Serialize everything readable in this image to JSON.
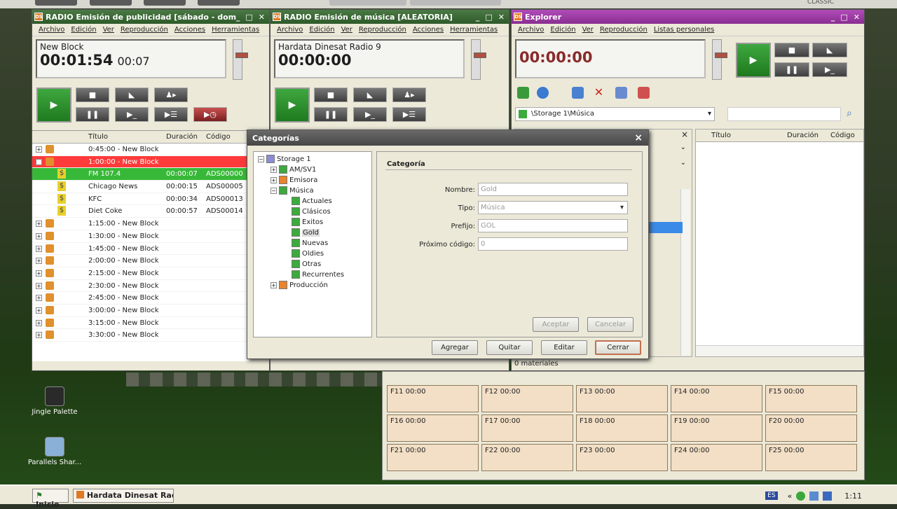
{
  "desktop": {
    "icons": [
      {
        "label": "Jingle Palette"
      },
      {
        "label": "Parallels Shar..."
      }
    ]
  },
  "ads_window": {
    "title": "RADIO Emisión de publicidad [sábado - domin...",
    "menu": [
      "Archivo",
      "Edición",
      "Ver",
      "Reproducción",
      "Acciones",
      "Herramientas"
    ],
    "display_line1": "New Block",
    "display_time": "00:01:54",
    "display_remaining": "00:07",
    "columns": [
      "Título",
      "Duración",
      "Código"
    ],
    "rows": [
      {
        "kind": "block",
        "title": "0:45:00 - New Block",
        "duration": "",
        "code": "",
        "expand": "+"
      },
      {
        "kind": "block-active",
        "title": "1:00:00 - New Block",
        "duration": "",
        "code": "",
        "expand": "−"
      },
      {
        "kind": "ad-playing",
        "title": "FM 107.4",
        "duration": "00:00:07",
        "code": "ADS00000"
      },
      {
        "kind": "ad",
        "title": "Chicago News",
        "duration": "00:00:15",
        "code": "ADS00005"
      },
      {
        "kind": "ad",
        "title": "KFC",
        "duration": "00:00:34",
        "code": "ADS00013"
      },
      {
        "kind": "ad",
        "title": "Diet Coke",
        "duration": "00:00:57",
        "code": "ADS00014"
      },
      {
        "kind": "block",
        "title": "1:15:00 - New Block",
        "duration": "",
        "code": "",
        "expand": "+"
      },
      {
        "kind": "block",
        "title": "1:30:00 - New Block",
        "duration": "",
        "code": "",
        "expand": "+"
      },
      {
        "kind": "block",
        "title": "1:45:00 - New Block",
        "duration": "",
        "code": "",
        "expand": "+"
      },
      {
        "kind": "block",
        "title": "2:00:00 - New Block",
        "duration": "",
        "code": "",
        "expand": "+"
      },
      {
        "kind": "block",
        "title": "2:15:00 - New Block",
        "duration": "",
        "code": "",
        "expand": "+"
      },
      {
        "kind": "block",
        "title": "2:30:00 - New Block",
        "duration": "",
        "code": "",
        "expand": "+"
      },
      {
        "kind": "block",
        "title": "2:45:00 - New Block",
        "duration": "",
        "code": "",
        "expand": "+"
      },
      {
        "kind": "block",
        "title": "3:00:00 - New Block",
        "duration": "",
        "code": "",
        "expand": "+"
      },
      {
        "kind": "block",
        "title": "3:15:00 - New Block",
        "duration": "",
        "code": "",
        "expand": "+"
      },
      {
        "kind": "block",
        "title": "3:30:00 - New Block",
        "duration": "",
        "code": "",
        "expand": "+"
      }
    ]
  },
  "music_window": {
    "title": "RADIO Emisión de música [ALEATORIA]",
    "menu": [
      "Archivo",
      "Edición",
      "Ver",
      "Reproducción",
      "Acciones",
      "Herramientas"
    ],
    "display_line1": "Hardata Dinesat Radio 9",
    "display_time": "00:00:00"
  },
  "explorer_window": {
    "title": "Explorer",
    "menu": [
      "Archivo",
      "Edición",
      "Ver",
      "Reproducción",
      "Listas personales"
    ],
    "display_time": "00:00:00",
    "path": "\\Storage 1\\Música",
    "columns": [
      "Título",
      "Duración",
      "Código"
    ],
    "status": "0 materiales"
  },
  "dialog": {
    "title": "Categorías",
    "close": "×",
    "tree": [
      {
        "label": "Storage 1",
        "icon": "db",
        "expand": "−"
      },
      {
        "label": "AM/SV1",
        "icon": "gn",
        "expand": "+"
      },
      {
        "label": "Emisora",
        "icon": "or",
        "expand": "+"
      },
      {
        "label": "Música",
        "icon": "gn",
        "expand": "−"
      },
      {
        "label": "Actuales",
        "icon": "gn"
      },
      {
        "label": "Clásicos",
        "icon": "gn"
      },
      {
        "label": "Exitos",
        "icon": "gn"
      },
      {
        "label": "Gold",
        "icon": "gn",
        "selected": true
      },
      {
        "label": "Nuevas",
        "icon": "gn"
      },
      {
        "label": "Oldies",
        "icon": "gn"
      },
      {
        "label": "Otras",
        "icon": "gn"
      },
      {
        "label": "Recurrentes",
        "icon": "gn"
      },
      {
        "label": "Producción",
        "icon": "or",
        "expand": "+"
      }
    ],
    "panel_title": "Categoría",
    "labels": {
      "nombre": "Nombre:",
      "tipo": "Tipo:",
      "prefijo": "Prefijo:",
      "proximo": "Próximo código:"
    },
    "values": {
      "nombre": "Gold",
      "tipo": "Música",
      "prefijo": "GOL",
      "proximo": "0"
    },
    "buttons": {
      "aceptar": "Aceptar",
      "cancelar": "Cancelar",
      "agregar": "Agregar",
      "quitar": "Quitar",
      "editar": "Editar",
      "cerrar": "Cerrar"
    }
  },
  "fkeys": [
    "F11 00:00",
    "F12 00:00",
    "F13 00:00",
    "F14 00:00",
    "F15 00:00",
    "F16 00:00",
    "F17 00:00",
    "F18 00:00",
    "F19 00:00",
    "F20 00:00",
    "F21 00:00",
    "F22 00:00",
    "F23 00:00",
    "F24 00:00",
    "F25 00:00"
  ],
  "taskbar": {
    "start": "Inicio",
    "task": "Hardata Dinesat Radi...",
    "lang": "ES",
    "clock": "1:11",
    "top_label": "CLASSIC"
  }
}
